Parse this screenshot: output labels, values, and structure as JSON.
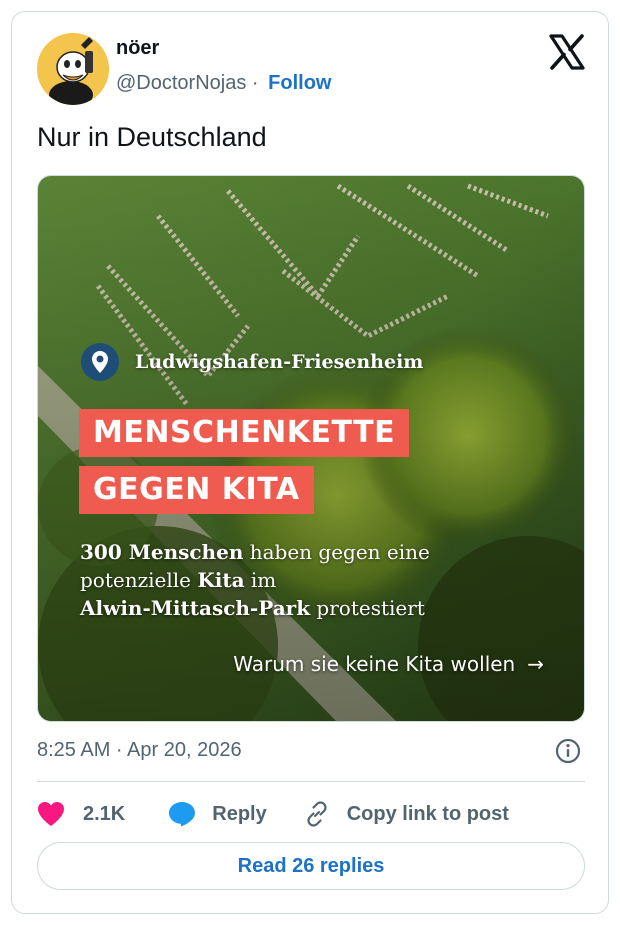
{
  "author": {
    "name": "nöer",
    "handle": "@DoctorNojas",
    "separator": "·",
    "follow_label": "Follow"
  },
  "tweet": {
    "text": "Nur in Deutschland"
  },
  "media": {
    "location": "Ludwigshafen-Friesenheim",
    "headline_line1": "MENSCHENKETTE",
    "headline_line2": "GEGEN KITA",
    "summary_bold1": "300 Menschen",
    "summary_text1": " haben gegen eine",
    "summary_text2": "potenzielle ",
    "summary_bold2": "Kita",
    "summary_text3": " im",
    "summary_bold3": "Alwin-Mittasch-Park",
    "summary_text4": " protestiert",
    "cta_label": "Warum sie keine Kita wollen",
    "cta_arrow": "→"
  },
  "meta": {
    "timestamp": "8:25 AM · Apr 20, 2026"
  },
  "actions": {
    "likes_count": "2.1K",
    "reply_label": "Reply",
    "copy_label": "Copy link to post"
  },
  "read_replies_label": "Read 26 replies",
  "colors": {
    "link": "#1d72c8",
    "like": "#f91880",
    "reply_icon": "#1d9bf0",
    "headline_bg": "#ef5b4f",
    "pin_bg": "#1e4e78"
  },
  "icons": {
    "brand": "x-logo-icon",
    "info": "info-icon",
    "like": "heart-icon",
    "reply": "speech-bubble-icon",
    "copy": "link-icon",
    "location": "location-pin-icon",
    "cta": "arrow-right-icon"
  }
}
